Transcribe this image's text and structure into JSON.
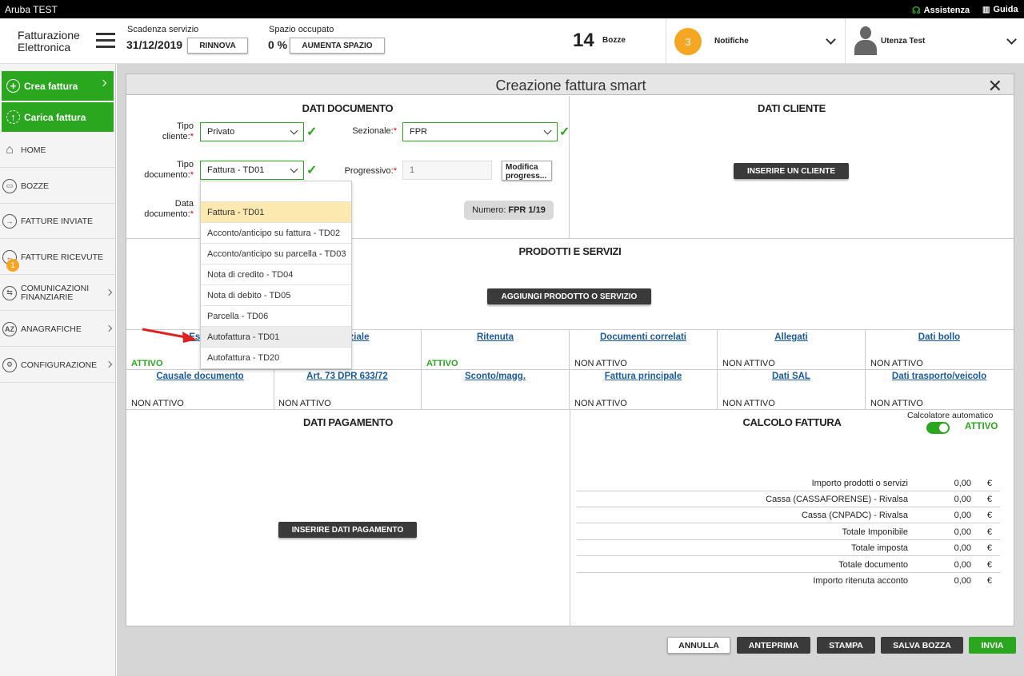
{
  "topbar": {
    "title": "Aruba TEST",
    "assistenza": "Assistenza",
    "guida": "Guida"
  },
  "header": {
    "logo_line1": "Fatturazione",
    "logo_line2": "Elettronica",
    "scadenza_label": "Scadenza servizio",
    "scadenza_value": "31/12/2019",
    "rinnova": "RINNOVA",
    "spazio_label": "Spazio occupato",
    "spazio_value": "0 %",
    "aumenta": "AUMENTA SPAZIO",
    "bozze_count": "14",
    "bozze_label": "Bozze",
    "notifiche_count": "3",
    "notifiche_label": "Notifiche",
    "user": "Utenza Test"
  },
  "sidebar": {
    "crea": "Crea fattura",
    "carica": "Carica fattura",
    "items": [
      {
        "label": "HOME",
        "icon": "home-icon"
      },
      {
        "label": "BOZZE",
        "icon": "drafts-icon"
      },
      {
        "label": "FATTURE INVIATE",
        "icon": "sent-icon"
      },
      {
        "label": "FATTURE RICEVUTE",
        "icon": "received-icon",
        "badge": "1"
      },
      {
        "label1": "COMUNICAZIONI",
        "label2": "FINANZIARIE",
        "icon": "exchange-icon"
      },
      {
        "label": "ANAGRAFICHE",
        "icon": "az-icon"
      },
      {
        "label": "CONFIGURAZIONE",
        "icon": "gear-icon"
      }
    ]
  },
  "modal": {
    "title": "Creazione fattura smart"
  },
  "documento": {
    "title": "DATI DOCUMENTO",
    "tipo_cliente_l1": "Tipo",
    "tipo_cliente_l2": "cliente:",
    "tipo_cliente_value": "Privato",
    "sezionale_label": "Sezionale:",
    "sezionale_value": "FPR",
    "tipo_doc_l1": "Tipo",
    "tipo_doc_l2": "documento:",
    "tipo_doc_value": "Fattura - TD01",
    "progressivo_label": "Progressivo:",
    "progressivo_placeholder": "1",
    "modifica_l1": "Modifica",
    "modifica_l2": "progress...",
    "data_l1": "Data",
    "data_l2": "documento:",
    "numero_label": "Numero:",
    "numero_value": "FPR 1/19"
  },
  "dropdown": {
    "options": [
      "Fattura - TD01",
      "Acconto/anticipo su fattura - TD02",
      "Acconto/anticipo su parcella - TD03",
      "Nota di credito - TD04",
      "Nota di debito - TD05",
      "Parcella - TD06",
      "Autofattura - TD01",
      "Autofattura - TD20"
    ]
  },
  "cliente": {
    "title": "DATI CLIENTE",
    "button": "INSERIRE UN CLIENTE"
  },
  "prodotti": {
    "title": "PRODOTTI E SERVIZI",
    "button": "AGGIUNGI PRODOTTO O SERVIZIO"
  },
  "options_row1": [
    {
      "label": "Esibi",
      "status": "ATTIVO"
    },
    {
      "label": "videnziale",
      "status": ""
    },
    {
      "label": "Ritenuta",
      "status": "ATTIVO"
    },
    {
      "label": "Documenti correlati",
      "status": "NON ATTIVO"
    },
    {
      "label": "Allegati",
      "status": "NON ATTIVO"
    },
    {
      "label": "Dati bollo",
      "status": "NON ATTIVO"
    }
  ],
  "options_row2": [
    {
      "label": "Causale documento",
      "status": "NON ATTIVO"
    },
    {
      "label": "Art. 73 DPR 633/72",
      "status": "NON ATTIVO"
    },
    {
      "label": "Sconto/magg.",
      "status": ""
    },
    {
      "label": "Fattura principale",
      "status": "NON ATTIVO"
    },
    {
      "label": "Dati SAL",
      "status": "NON ATTIVO"
    },
    {
      "label": "Dati trasporto/veicolo",
      "status": "NON ATTIVO"
    }
  ],
  "pagamento": {
    "title": "DATI PAGAMENTO",
    "button": "INSERIRE DATI PAGAMENTO"
  },
  "calcolo": {
    "title": "CALCOLO FATTURA",
    "auto_label": "Calcolatore automatico",
    "auto_status": "ATTIVO",
    "rows": [
      {
        "label": "Importo prodotti o servizi",
        "value": "0,00",
        "cur": "€"
      },
      {
        "label": "Cassa (CASSAFORENSE) - Rivalsa",
        "value": "0,00",
        "cur": "€"
      },
      {
        "label": "Cassa (CNPADC) - Rivalsa",
        "value": "0,00",
        "cur": "€"
      },
      {
        "label": "Totale Imponibile",
        "value": "0,00",
        "cur": "€"
      },
      {
        "label": "Totale imposta",
        "value": "0,00",
        "cur": "€"
      },
      {
        "label": "Totale documento",
        "value": "0,00",
        "cur": "€"
      },
      {
        "label": "Importo ritenuta acconto",
        "value": "0,00",
        "cur": "€"
      }
    ]
  },
  "footer": {
    "annulla": "ANNULLA",
    "anteprima": "ANTEPRIMA",
    "stampa": "STAMPA",
    "salva": "SALVA BOZZA",
    "invia": "INVIA"
  },
  "colors": {
    "green": "#2aa61f",
    "dark": "#3a3a3a",
    "orange": "#f5a623",
    "link": "#1a5a9a"
  }
}
